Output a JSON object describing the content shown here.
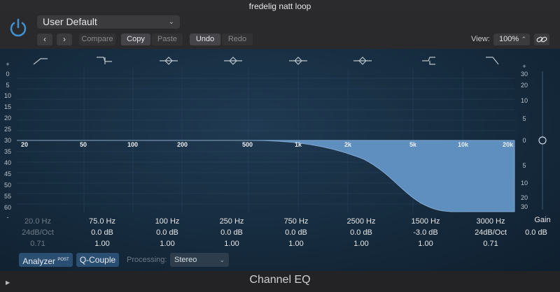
{
  "window": {
    "title": "fredelig natt loop"
  },
  "header": {
    "preset": "User Default",
    "buttons": {
      "compare": "Compare",
      "copy": "Copy",
      "paste": "Paste",
      "undo": "Undo",
      "redo": "Redo"
    },
    "view_label": "View:",
    "view_value": "100%"
  },
  "graph": {
    "left_scale": [
      "+",
      "0",
      "5",
      "10",
      "15",
      "20",
      "25",
      "30",
      "35",
      "40",
      "45",
      "50",
      "55",
      "60",
      "-"
    ],
    "right_scale": [
      "30",
      "20",
      "10",
      "5",
      "0",
      "5",
      "10",
      "20",
      "30"
    ],
    "right_scale_top": "+",
    "freq_labels": [
      "20",
      "50",
      "100",
      "200",
      "500",
      "1k",
      "2k",
      "5k",
      "10k",
      "20k"
    ]
  },
  "bands": [
    {
      "freq": "20.0 Hz",
      "gain": "24dB/Oct",
      "q": "0.71",
      "enabled": false,
      "type": "highpass"
    },
    {
      "freq": "75.0 Hz",
      "gain": "0.0 dB",
      "q": "1.00",
      "enabled": true,
      "type": "lowshelf"
    },
    {
      "freq": "100 Hz",
      "gain": "0.0 dB",
      "q": "1.00",
      "enabled": true,
      "type": "peak"
    },
    {
      "freq": "250 Hz",
      "gain": "0.0 dB",
      "q": "1.00",
      "enabled": true,
      "type": "peak"
    },
    {
      "freq": "750 Hz",
      "gain": "0.0 dB",
      "q": "1.00",
      "enabled": true,
      "type": "peak"
    },
    {
      "freq": "2500 Hz",
      "gain": "0.0 dB",
      "q": "1.00",
      "enabled": true,
      "type": "peak"
    },
    {
      "freq": "1500 Hz",
      "gain": "-3.0 dB",
      "q": "1.00",
      "enabled": true,
      "type": "highshelf"
    },
    {
      "freq": "3000 Hz",
      "gain": "24dB/Oct",
      "q": "0.71",
      "enabled": true,
      "type": "lowpass"
    }
  ],
  "gain": {
    "label": "Gain",
    "value": "0.0 dB"
  },
  "footer": {
    "analyzer": "Analyzer",
    "analyzer_tag": "POST",
    "qcouple": "Q-Couple",
    "processing_label": "Processing:",
    "processing_value": "Stereo",
    "plugin_name": "Channel EQ"
  },
  "colors": {
    "accent": "#3d93d6",
    "curve_fill": "#5f8fbf"
  }
}
